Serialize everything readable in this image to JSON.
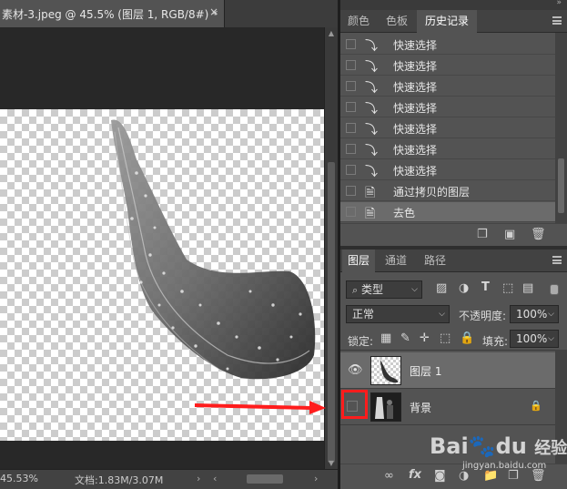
{
  "document": {
    "tab_title": "素材-3.jpeg @ 45.5% (图层 1, RGB/8#) *",
    "close_glyph": "×"
  },
  "statusbar": {
    "zoom": "45.53%",
    "doc_info": "文档:1.83M/3.07M",
    "arrow_right": "›",
    "arrow_left": "‹"
  },
  "history_panel": {
    "tabs": [
      {
        "label": "颜色",
        "active": false
      },
      {
        "label": "色板",
        "active": false
      },
      {
        "label": "历史记录",
        "active": true
      }
    ],
    "items": [
      {
        "label": "快速选择",
        "icon": "quick-selection-icon",
        "active": false
      },
      {
        "label": "快速选择",
        "icon": "quick-selection-icon",
        "active": false
      },
      {
        "label": "快速选择",
        "icon": "quick-selection-icon",
        "active": false
      },
      {
        "label": "快速选择",
        "icon": "quick-selection-icon",
        "active": false
      },
      {
        "label": "快速选择",
        "icon": "quick-selection-icon",
        "active": false
      },
      {
        "label": "快速选择",
        "icon": "quick-selection-icon",
        "active": false
      },
      {
        "label": "快速选择",
        "icon": "quick-selection-icon",
        "active": false
      },
      {
        "label": "通过拷贝的图层",
        "icon": "document-icon",
        "active": false
      },
      {
        "label": "去色",
        "icon": "document-icon",
        "active": true
      }
    ]
  },
  "layers_panel": {
    "tabs": [
      {
        "label": "图层",
        "active": true
      },
      {
        "label": "通道",
        "active": false
      },
      {
        "label": "路径",
        "active": false
      }
    ],
    "filter": {
      "label": "类型"
    },
    "blend_mode": "正常",
    "opacity": {
      "label": "不透明度:",
      "value": "100%"
    },
    "lock": {
      "label": "锁定:"
    },
    "fill": {
      "label": "填充:",
      "value": "100%"
    },
    "layers": [
      {
        "name": "图层 1",
        "visible": true,
        "selected": true,
        "locked": false
      },
      {
        "name": "背景",
        "visible": false,
        "selected": false,
        "locked": true
      }
    ],
    "footer_fx": "fx"
  },
  "watermark": {
    "logo_text_a": "Bai",
    "logo_text_b": "du",
    "logo_cn": "经验",
    "sub": "jingyan.baidu.com"
  },
  "colors": {
    "highlight_red": "#ff1c1c",
    "panel_bg": "#535353",
    "selected_row": "#6b6b6b"
  }
}
